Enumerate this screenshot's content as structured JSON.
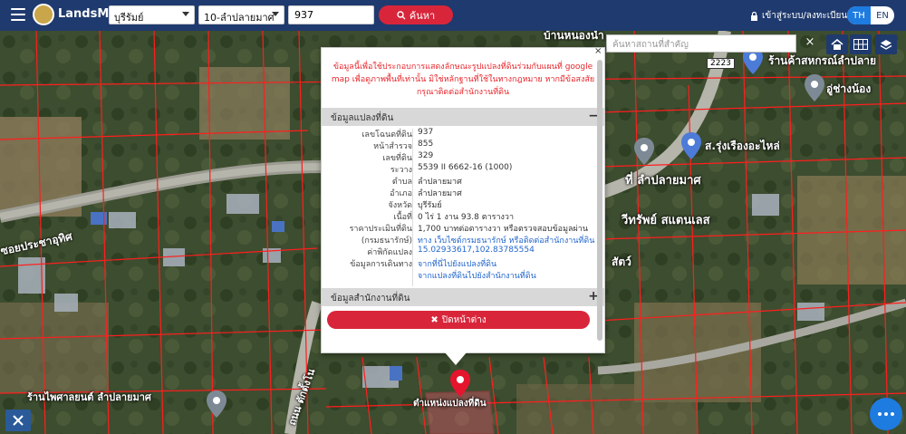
{
  "header": {
    "brand": "LandsMaps",
    "province_select": "บุรีรัมย์",
    "district_select": "10-ลำปลายมาศ",
    "deed_input": "937",
    "search_button": "ค้นหา",
    "login_label": "เข้าสู่ระบบ/ลงทะเบียน",
    "lang_th": "TH",
    "lang_en": "EN"
  },
  "map": {
    "search_placeholder": "ค้นหาสถานที่สำคัญ",
    "clear": "×",
    "labels": {
      "road_top": "บ้านหนองน้ำ",
      "shop_top_right": "ร้านค้าสหกรณ์ลำปลาย",
      "shop_right": "อู่ช่างน้อง",
      "shop_mid_right": "ส.รุ่งเรืองอะไหล่",
      "place_mid": "ที่ ลำปลายมาศ",
      "place_lower": "วีทรัพย์ สแตนเลส",
      "road_left": "ซอยประชาอุทิศ",
      "shop_bottom_left": "ร้านไพศาลยนต์ ลำปลายมาศ",
      "road_bottom": "ถนน ตักตั้งโน",
      "parcel_label": "ตำแหน่งแปลงที่ดิน",
      "route_badge": "2223",
      "shop_small": "สัตว์"
    }
  },
  "popup": {
    "close_x": "×",
    "warning": "ข้อมูลนี้เพื่อใช้ประกอบการแสดงลักษณะรูปแปลงที่ดินร่วมกับแผนที่ google map เพื่อดูภาพพื้นที่เท่านั้น มิใช่หลักฐานที่ใช้ในทางกฎหมาย หากมีข้อสงสัย กรุณาติดต่อสำนักงานที่ดิน",
    "section_parcel": "ข้อมูลแปลงที่ดิน",
    "section_parcel_sign": "−",
    "section_office": "ข้อมูลสำนักงานที่ดิน",
    "section_office_sign": "+",
    "rows": [
      {
        "k": "เลขโฉนดที่ดิน",
        "v": "937"
      },
      {
        "k": "หน้าสำรวจ",
        "v": "855"
      },
      {
        "k": "เลขที่ดิน",
        "v": "329"
      },
      {
        "k": "ระวาง",
        "v": "5539 II 6662-16 (1000)"
      },
      {
        "k": "ตำบล",
        "v": "ลำปลายมาศ"
      },
      {
        "k": "อำเภอ",
        "v": "ลำปลายมาศ"
      },
      {
        "k": "จังหวัด",
        "v": "บุรีรัมย์"
      },
      {
        "k": "เนื้อที่",
        "v": "0 ไร่ 1 งาน 93.8 ตารางวา"
      },
      {
        "k": "ราคาประเมินที่ดิน",
        "v": "1,700 บาทต่อตารางวา หรือตรวจสอบข้อมูลผ่าน"
      },
      {
        "k": "(กรมธนารักษ์)",
        "v": "ทาง เว็บไซต์กรมธนารักษ์ หรือติดต่อสำนักงานที่ดิน"
      },
      {
        "k": "ค่าพิกัดแปลง",
        "v": "15.02933617,102.83785554"
      },
      {
        "k": "ข้อมูลการเดินทาง",
        "v": "จากที่นี่ไปยังแปลงที่ดิน"
      },
      {
        "k": "",
        "v": "จากแปลงที่ดินไปยังสำนักงานที่ดิน"
      }
    ],
    "close_button": "ปิดหน้าต่าง"
  },
  "colors": {
    "navy": "#1f3a6e",
    "red": "#d9253a",
    "blue": "#1e7be0",
    "link": "#2266cc"
  }
}
